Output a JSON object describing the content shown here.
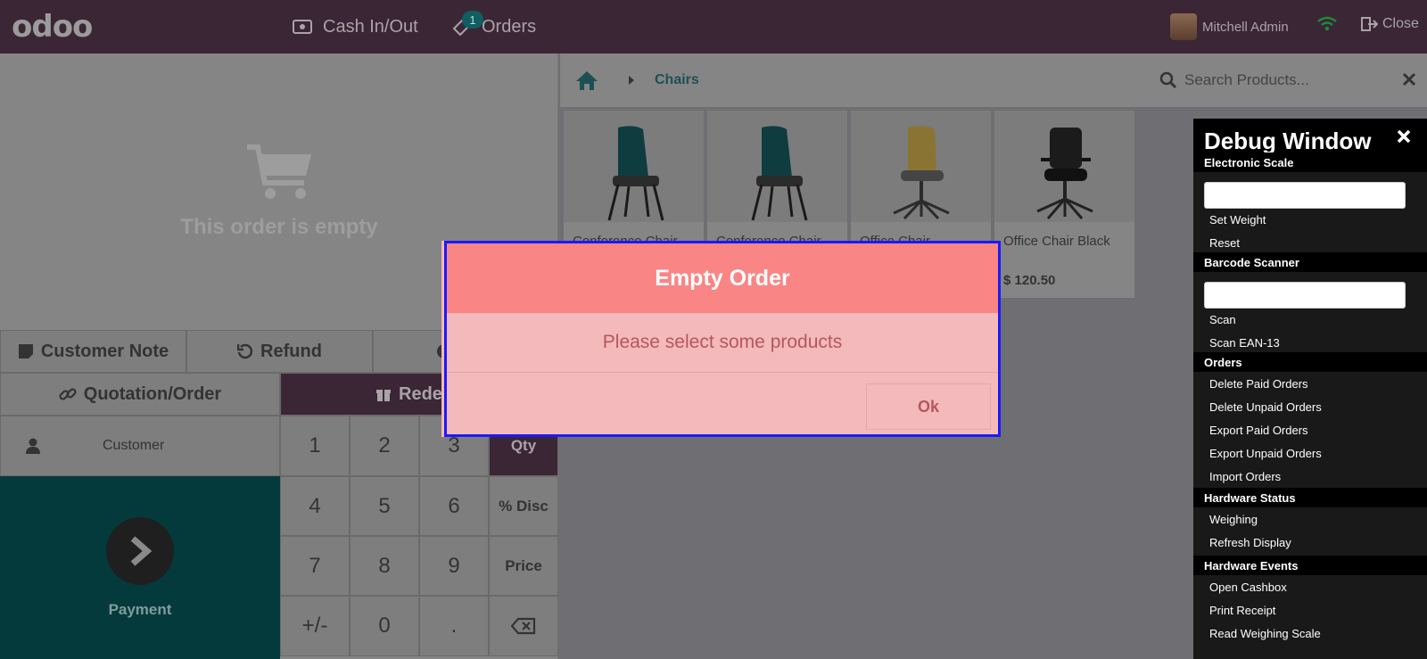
{
  "topbar": {
    "logo": "odoo",
    "cash_label": "Cash In/Out",
    "orders_label": "Orders",
    "orders_count": "1",
    "user_name": "Mitchell Admin",
    "close_label": "Close"
  },
  "left": {
    "empty_text": "This order is empty",
    "customer_note": "Customer Note",
    "refund": "Refund",
    "quotation": "Quotation/Order",
    "redeem": "Redee",
    "customer": "Customer",
    "payment": "Payment"
  },
  "numpad": {
    "keys": [
      "1",
      "2",
      "3",
      "Qty",
      "4",
      "5",
      "6",
      "% Disc",
      "7",
      "8",
      "9",
      "Price",
      "+/-",
      "0",
      "."
    ]
  },
  "breadcrumb": {
    "category": "Chairs"
  },
  "search": {
    "placeholder": "Search Products..."
  },
  "products": [
    {
      "name": "Conference Chair",
      "price": ""
    },
    {
      "name": "Conference Chair",
      "price": ""
    },
    {
      "name": "Office Chair",
      "price": ""
    },
    {
      "name": "Office Chair Black",
      "price": "$ 120.50"
    }
  ],
  "debug": {
    "title": "Debug Window",
    "sections": {
      "scale": "Electronic Scale",
      "barcode": "Barcode Scanner",
      "orders": "Orders",
      "hw_status": "Hardware Status",
      "hw_events": "Hardware Events"
    },
    "items": {
      "set_weight": "Set Weight",
      "reset": "Reset",
      "scan": "Scan",
      "scan_ean": "Scan EAN-13",
      "delete_paid": "Delete Paid Orders",
      "delete_unpaid": "Delete Unpaid Orders",
      "export_paid": "Export Paid Orders",
      "export_unpaid": "Export Unpaid Orders",
      "import_orders": "Import Orders",
      "weighing": "Weighing",
      "refresh_display": "Refresh Display",
      "open_cashbox": "Open Cashbox",
      "print_receipt": "Print Receipt",
      "read_scale": "Read Weighing Scale"
    }
  },
  "modal": {
    "title": "Empty Order",
    "message": "Please select some products",
    "ok": "Ok"
  },
  "colors": {
    "topbar": "#3b2635",
    "payment": "#053a3c",
    "modal_header": "#f98585",
    "modal_body": "#f3b9bb",
    "modal_border": "#1a1aff"
  }
}
